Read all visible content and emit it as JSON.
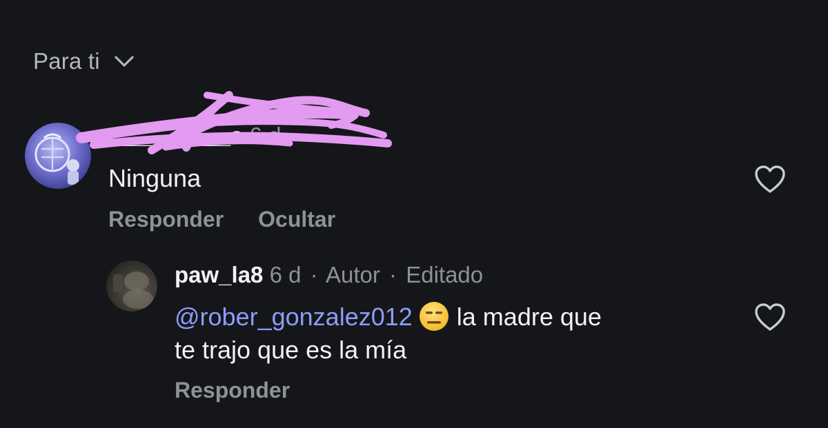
{
  "header": {
    "sort_label": "Para ti"
  },
  "comments": [
    {
      "username": "r_________s",
      "time": "6 d",
      "text": "Ninguna",
      "actions": {
        "reply": "Responder",
        "hide": "Ocultar"
      }
    },
    {
      "username": "paw_la8",
      "time": "6 d",
      "author_badge": "Autor",
      "edited_label": "Editado",
      "separator": "·",
      "mention": "@rober_gonzalez012",
      "emoji": "expressionless-face",
      "text_line1": "la madre que",
      "text_line2": "te trajo que es la mía",
      "actions": {
        "reply": "Responder"
      }
    }
  ],
  "colors": {
    "background": "#15161a",
    "mention": "#8c9dfb",
    "muted": "#8f9198",
    "redaction": "#e39af1"
  }
}
